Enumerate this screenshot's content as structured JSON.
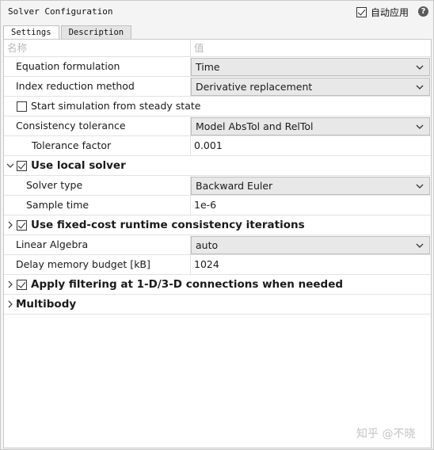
{
  "title": "Solver Configuration",
  "auto_apply": {
    "label": "自动应用",
    "checked": true
  },
  "tabs": [
    {
      "label": "Settings",
      "active": true
    },
    {
      "label": "Description",
      "active": false
    }
  ],
  "header": {
    "name": "名称",
    "value": "值"
  },
  "rows": {
    "equation_formulation": {
      "name": "Equation formulation",
      "value": "Time"
    },
    "index_reduction": {
      "name": "Index reduction method",
      "value": "Derivative replacement"
    },
    "steady_state": {
      "name": "Start simulation from steady state",
      "checked": false
    },
    "consistency_tolerance": {
      "name": "Consistency tolerance",
      "value": "Model AbsTol and RelTol"
    },
    "tolerance_factor": {
      "name": "Tolerance factor",
      "value": "0.001"
    },
    "use_local_solver": {
      "name": "Use local solver",
      "checked": true,
      "expanded": true
    },
    "solver_type": {
      "name": "Solver type",
      "value": "Backward Euler"
    },
    "sample_time": {
      "name": "Sample time",
      "value": "1e-6"
    },
    "fixed_cost": {
      "name": "Use fixed-cost runtime consistency iterations",
      "checked": true,
      "expanded": false
    },
    "linear_algebra": {
      "name": "Linear Algebra",
      "value": "auto"
    },
    "delay_memory": {
      "name": "Delay memory budget [kB]",
      "value": "1024"
    },
    "apply_filtering": {
      "name": "Apply filtering at 1-D/3-D connections when needed",
      "checked": true,
      "expanded": false
    },
    "multibody": {
      "name": "Multibody",
      "expanded": false
    }
  },
  "watermark": "知乎 @不晓"
}
